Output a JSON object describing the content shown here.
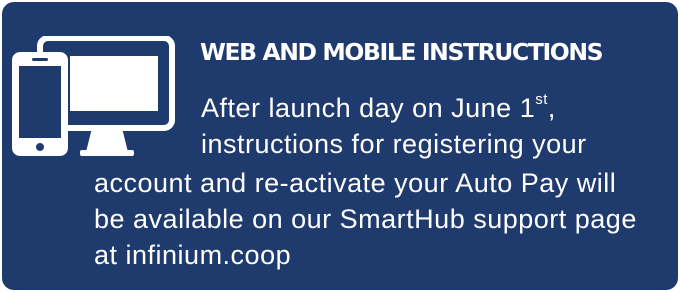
{
  "card": {
    "background_color": "#1f3a6d",
    "text_color": "#ffffff",
    "icon": "desktop-and-smartphone-icon",
    "heading": "WEB AND MOBILE INSTRUCTIONS",
    "body": {
      "line1_text": "After launch day on June 1",
      "line1_superscript": "st",
      "line1_suffix": ",",
      "line2": "instructions for registering your",
      "line3": "account and re-activate your Auto Pay will",
      "line4": "be available on our SmartHub support page",
      "line5": "at infinium.coop"
    }
  }
}
